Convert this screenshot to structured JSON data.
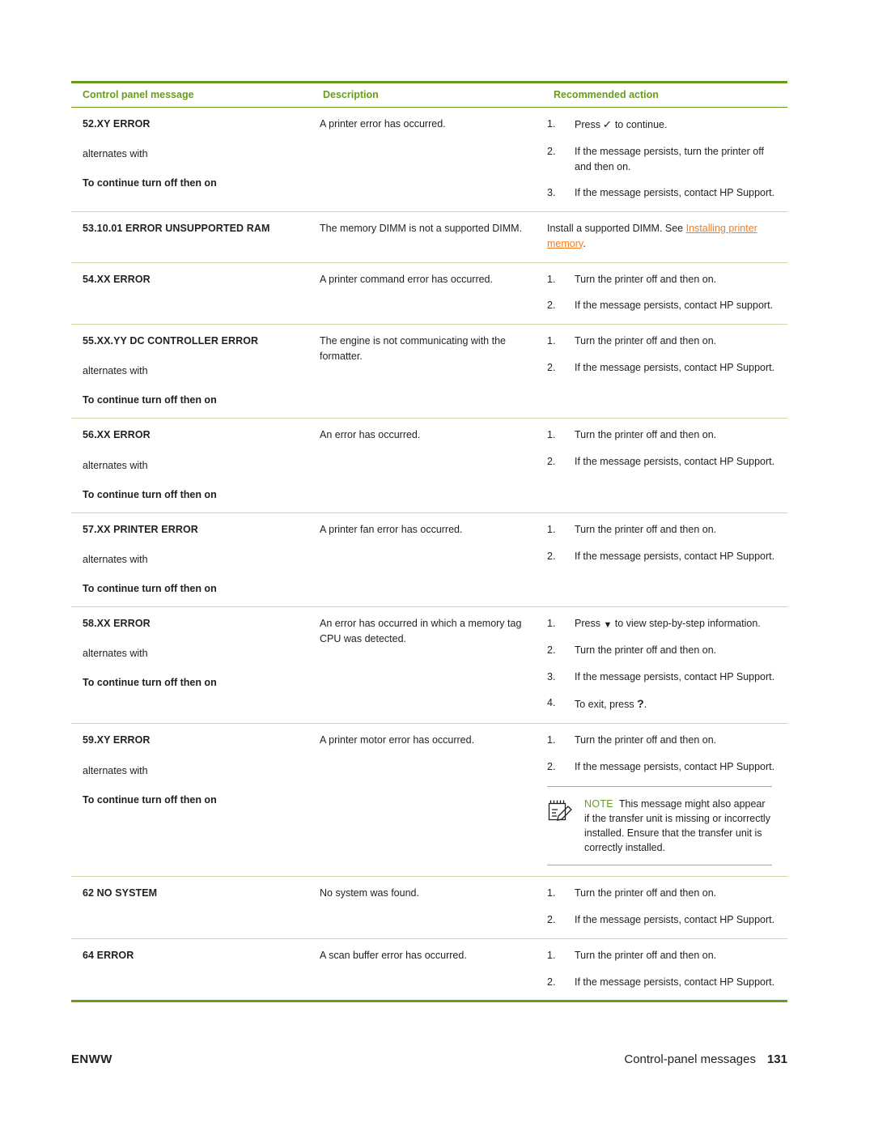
{
  "table": {
    "headers": [
      "Control panel message",
      "Description",
      "Recommended action"
    ],
    "rows": [
      {
        "message": "52.XY ERROR",
        "alternates_label": "alternates with",
        "alternate_message": "To continue turn off then on",
        "description": "A printer error has occurred.",
        "actions": [
          {
            "num": "1.",
            "pre": "Press ",
            "glyph": "check",
            "post": " to continue."
          },
          {
            "num": "2.",
            "text": "If the message persists, turn the printer off and then on."
          },
          {
            "num": "3.",
            "text": "If the message persists, contact HP Support."
          }
        ]
      },
      {
        "message": "53.10.01 ERROR UNSUPPORTED RAM",
        "description": "The memory DIMM is not a supported DIMM.",
        "action_text_pre": "Install a supported DIMM. See ",
        "action_link": "Installing printer memory",
        "action_text_post": "."
      },
      {
        "message": "54.XX ERROR",
        "description": "A printer command error has occurred.",
        "actions": [
          {
            "num": "1.",
            "text": "Turn the printer off and then on."
          },
          {
            "num": "2.",
            "text": "If the message persists, contact HP support."
          }
        ]
      },
      {
        "message": "55.XX.YY DC CONTROLLER ERROR",
        "alternates_label": "alternates with",
        "alternate_message": "To continue turn off then on",
        "description": "The engine is not communicating with the formatter.",
        "actions": [
          {
            "num": "1.",
            "text": "Turn the printer off and then on."
          },
          {
            "num": "2.",
            "text": "If the message persists, contact HP Support."
          }
        ]
      },
      {
        "message": "56.XX ERROR",
        "alternates_label": "alternates with",
        "alternate_message": "To continue turn off then on",
        "description": "An error has occurred.",
        "actions": [
          {
            "num": "1.",
            "text": "Turn the printer off and then on."
          },
          {
            "num": "2.",
            "text": "If the message persists, contact HP Support."
          }
        ]
      },
      {
        "message": "57.XX PRINTER ERROR",
        "alternates_label": "alternates with",
        "alternate_message": "To continue turn off then on",
        "description": "A printer fan error has occurred.",
        "actions": [
          {
            "num": "1.",
            "text": "Turn the printer off and then on."
          },
          {
            "num": "2.",
            "text": "If the message persists, contact HP Support."
          }
        ]
      },
      {
        "message": "58.XX ERROR",
        "alternates_label": "alternates with",
        "alternate_message": "To continue turn off then on",
        "description": "An error has occurred in which a memory tag CPU was detected.",
        "actions": [
          {
            "num": "1.",
            "pre": "Press ",
            "glyph": "down",
            "post": " to view step-by-step information."
          },
          {
            "num": "2.",
            "text": "Turn the printer off and then on."
          },
          {
            "num": "3.",
            "text": "If the message persists, contact HP Support."
          },
          {
            "num": "4.",
            "pre": "To exit, press ",
            "glyph": "question",
            "post": "."
          }
        ]
      },
      {
        "message": "59.XY ERROR",
        "alternates_label": "alternates with",
        "alternate_message": "To continue turn off then on",
        "description": "A printer motor error has occurred.",
        "actions": [
          {
            "num": "1.",
            "text": "Turn the printer off and then on."
          },
          {
            "num": "2.",
            "text": "If the message persists, contact HP Support."
          }
        ],
        "note": {
          "label": "NOTE",
          "text": "This message might also appear if the transfer unit is missing or incorrectly installed. Ensure that the transfer unit is correctly installed."
        }
      },
      {
        "message": "62 NO SYSTEM",
        "description": "No system was found.",
        "actions": [
          {
            "num": "1.",
            "text": "Turn the printer off and then on."
          },
          {
            "num": "2.",
            "text": "If the message persists, contact HP Support."
          }
        ]
      },
      {
        "message": "64 ERROR",
        "description": "A scan buffer error has occurred.",
        "actions": [
          {
            "num": "1.",
            "text": "Turn the printer off and then on."
          },
          {
            "num": "2.",
            "text": "If the message persists, contact HP Support."
          }
        ]
      }
    ]
  },
  "footer": {
    "left": "ENWW",
    "right": "Control-panel messages",
    "page": "131"
  },
  "colors": {
    "accent_green": "#6c9a1f",
    "link_orange": "#f47c20",
    "rule_light": "#c9d9a8"
  }
}
